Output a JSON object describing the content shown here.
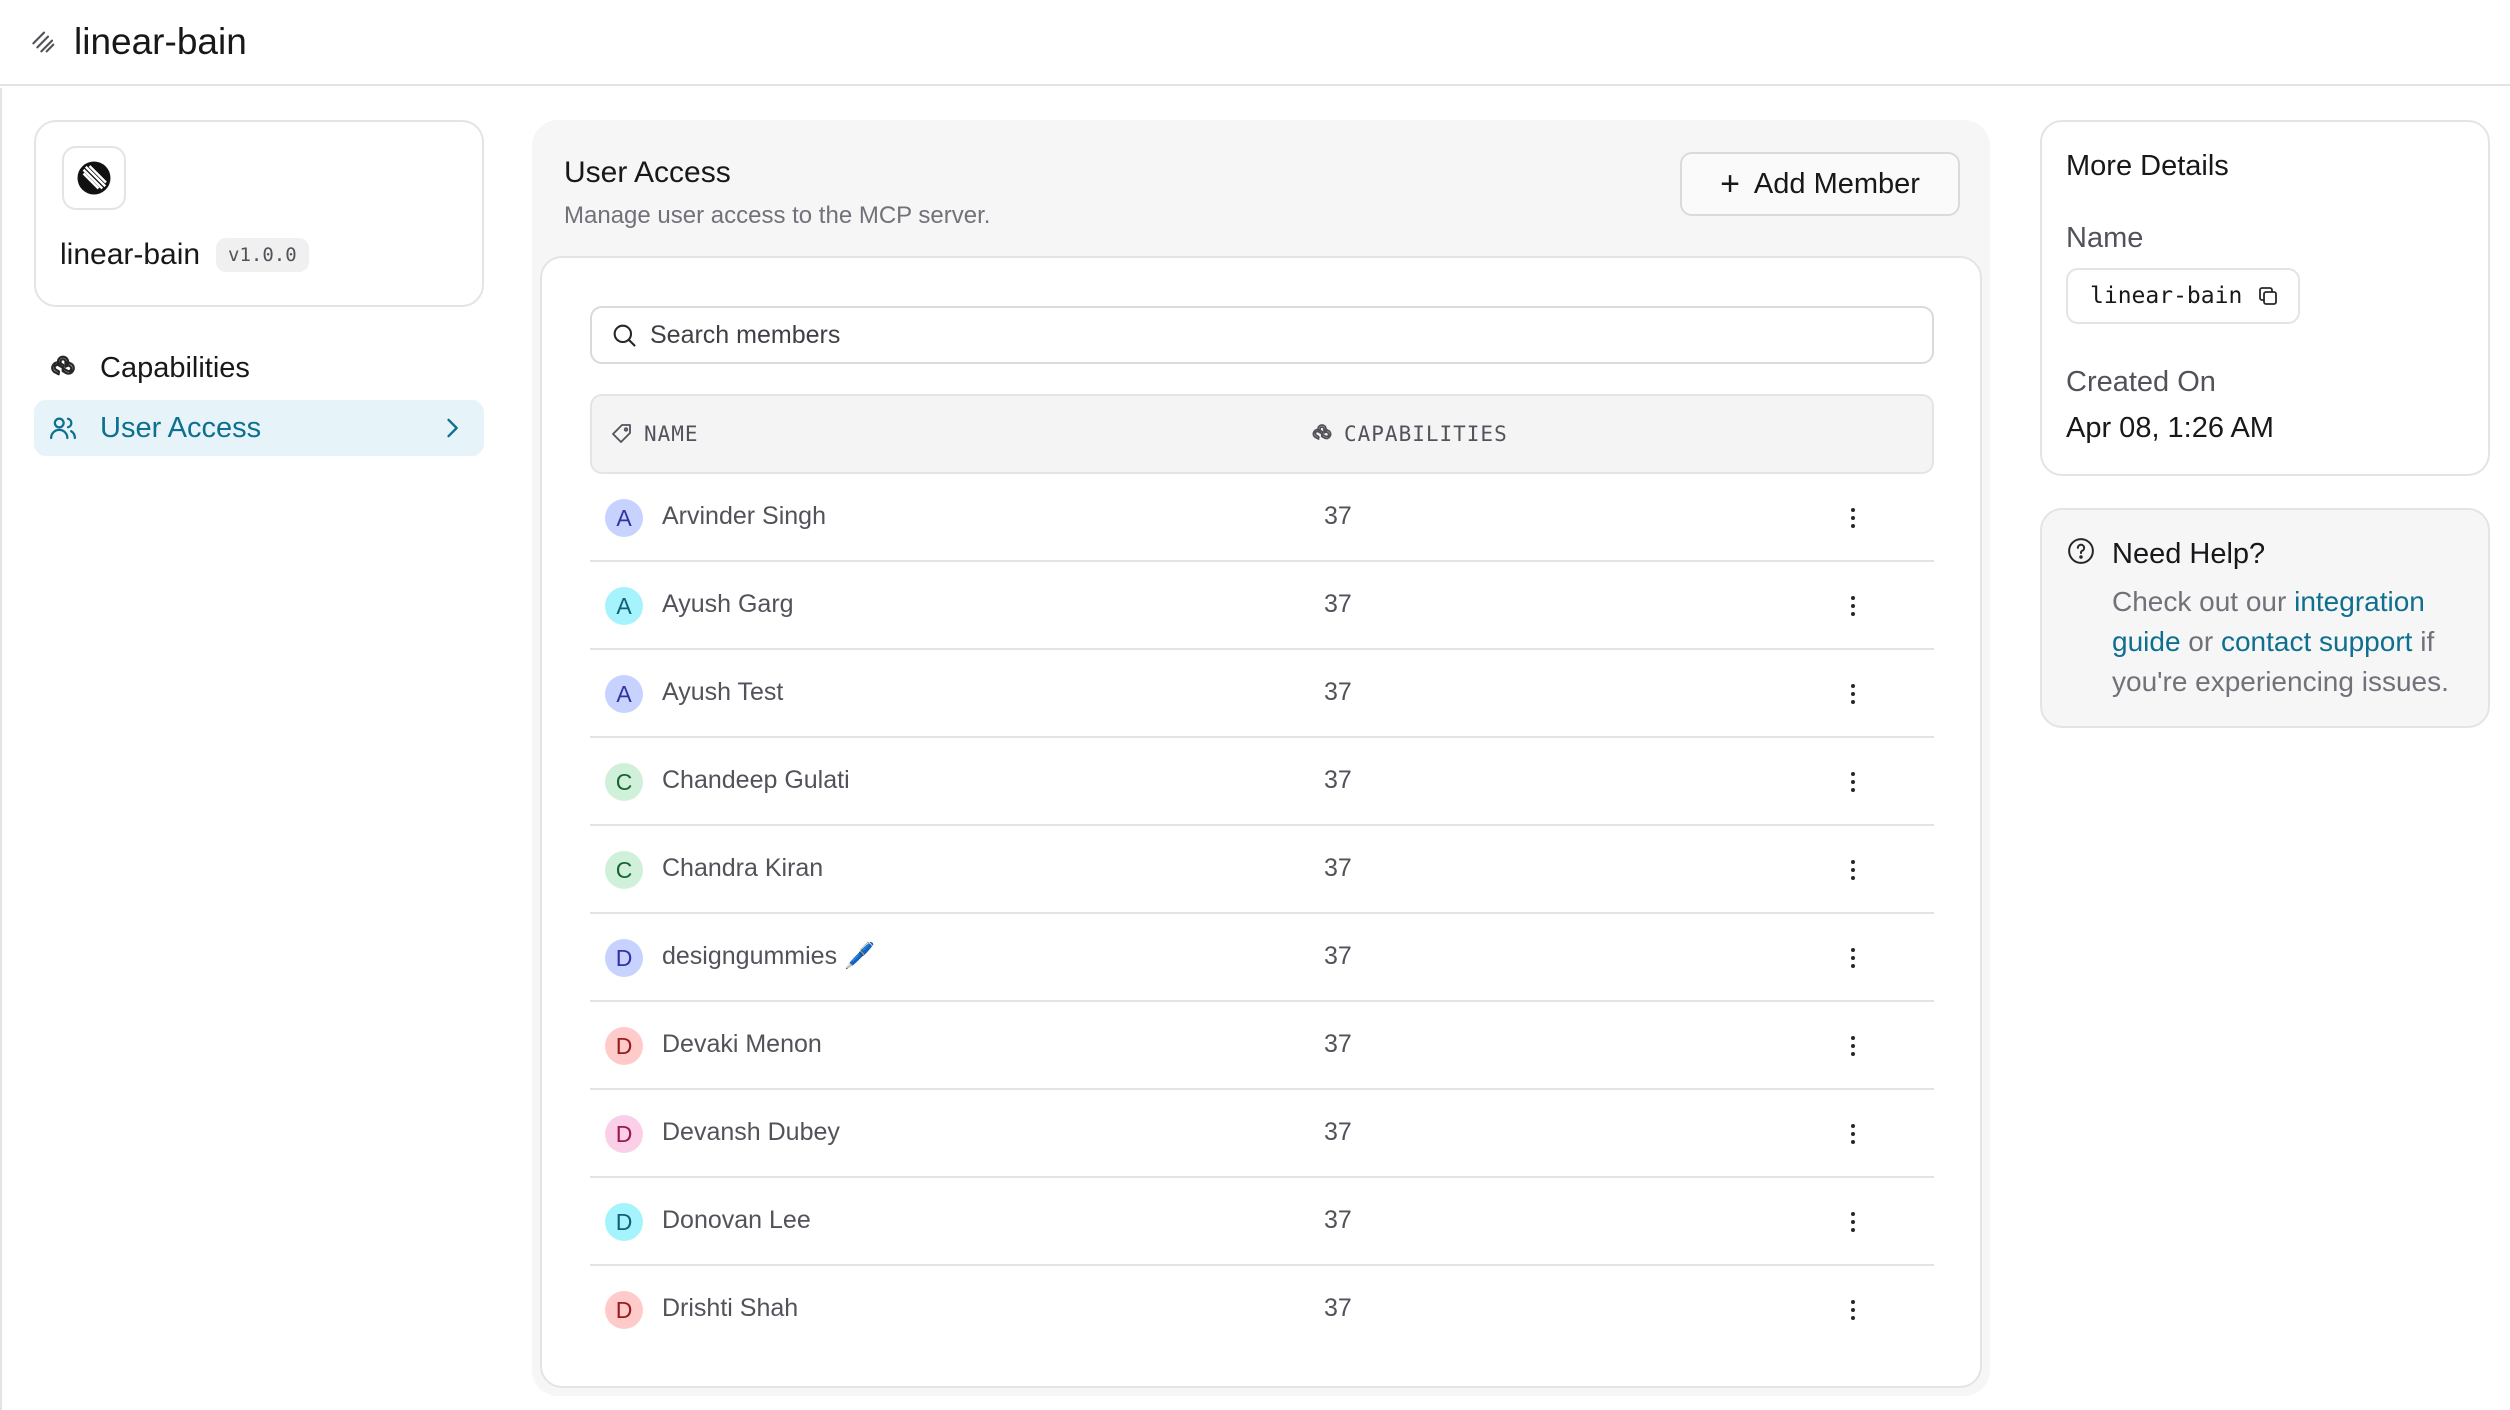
{
  "header": {
    "title": "linear-bain"
  },
  "server": {
    "name": "linear-bain",
    "version": "v1.0.0"
  },
  "nav": {
    "capabilities_label": "Capabilities",
    "user_access_label": "User Access"
  },
  "main": {
    "title": "User Access",
    "subtitle": "Manage user access to the MCP server.",
    "add_member_label": "Add Member",
    "search_placeholder": "Search members",
    "columns": {
      "name": "NAME",
      "capabilities": "CAPABILITIES"
    },
    "members": [
      {
        "initial": "A",
        "name": "Arvinder Singh",
        "capabilities": "37",
        "avatar_bg": "#c7d2fe",
        "avatar_fg": "#3730a3"
      },
      {
        "initial": "A",
        "name": "Ayush Garg",
        "capabilities": "37",
        "avatar_bg": "#a5f3fc",
        "avatar_fg": "#155e75"
      },
      {
        "initial": "A",
        "name": "Ayush Test",
        "capabilities": "37",
        "avatar_bg": "#c7d2fe",
        "avatar_fg": "#3730a3"
      },
      {
        "initial": "C",
        "name": "Chandeep Gulati",
        "capabilities": "37",
        "avatar_bg": "#d1f0d9",
        "avatar_fg": "#166534"
      },
      {
        "initial": "C",
        "name": "Chandra Kiran",
        "capabilities": "37",
        "avatar_bg": "#d1f0d9",
        "avatar_fg": "#166534"
      },
      {
        "initial": "D",
        "name": "designgummies 🖊️",
        "capabilities": "37",
        "avatar_bg": "#c7d2fe",
        "avatar_fg": "#3730a3"
      },
      {
        "initial": "D",
        "name": "Devaki Menon",
        "capabilities": "37",
        "avatar_bg": "#fecaca",
        "avatar_fg": "#991b1b"
      },
      {
        "initial": "D",
        "name": "Devansh Dubey",
        "capabilities": "37",
        "avatar_bg": "#fbcfe8",
        "avatar_fg": "#9d174d"
      },
      {
        "initial": "D",
        "name": "Donovan Lee",
        "capabilities": "37",
        "avatar_bg": "#a5f3fc",
        "avatar_fg": "#155e75"
      },
      {
        "initial": "D",
        "name": "Drishti Shah",
        "capabilities": "37",
        "avatar_bg": "#fecaca",
        "avatar_fg": "#991b1b"
      }
    ]
  },
  "details": {
    "title": "More Details",
    "name_label": "Name",
    "name_value": "linear-bain",
    "created_label": "Created On",
    "created_value": "Apr 08, 1:26 AM"
  },
  "help": {
    "title": "Need Help?",
    "text_1": "Check out our ",
    "link_1": "integration guide",
    "text_2": " or ",
    "link_2": "contact support",
    "text_3": " if you're experiencing issues."
  },
  "colors": {
    "accent": "#0e6f8f",
    "active_nav_bg": "#e6f4f9",
    "border": "#e4e4e7"
  }
}
